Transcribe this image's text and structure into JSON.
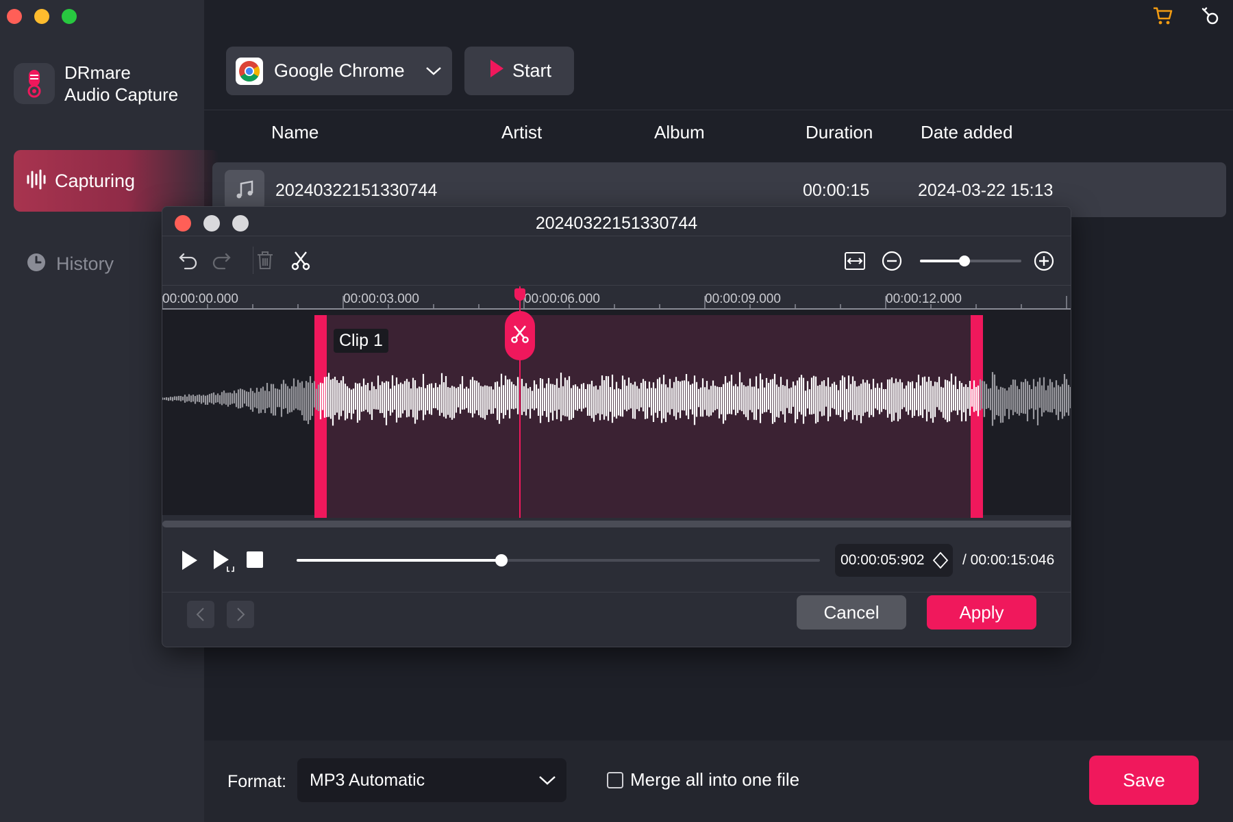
{
  "app": {
    "name_line1": "DRmare",
    "name_line2": "Audio Capture",
    "accent": "#f0185c"
  },
  "sidebar": {
    "items": [
      {
        "label": "Capturing",
        "icon": "waveform-icon",
        "active": true
      },
      {
        "label": "History",
        "icon": "clock-icon",
        "active": false
      }
    ]
  },
  "toolbar": {
    "source_label": "Google Chrome",
    "start_label": "Start",
    "icons": [
      "cart-icon",
      "key-icon"
    ]
  },
  "table": {
    "headers": [
      "Name",
      "Artist",
      "Album",
      "Duration",
      "Date added"
    ],
    "rows": [
      {
        "name": "20240322151330744",
        "artist": "",
        "album": "",
        "duration": "00:00:15",
        "date_added": "2024-03-22 15:13"
      }
    ]
  },
  "editor": {
    "title": "20240322151330744",
    "ruler_labels": [
      "00:00:00.000",
      "00:00:03.000",
      "00:00:06.000",
      "00:00:09.000",
      "00:00:12.000"
    ],
    "clip_label": "Clip 1",
    "zoom_level": 0.44,
    "playback_progress": 0.392,
    "current_time": "00:00:05:902",
    "total_time": "/ 00:00:15:046",
    "cancel_label": "Cancel",
    "apply_label": "Apply"
  },
  "footer": {
    "format_label": "Format:",
    "format_value": "MP3 Automatic",
    "merge_label": "Merge all into one file",
    "merge_checked": false,
    "save_label": "Save"
  }
}
